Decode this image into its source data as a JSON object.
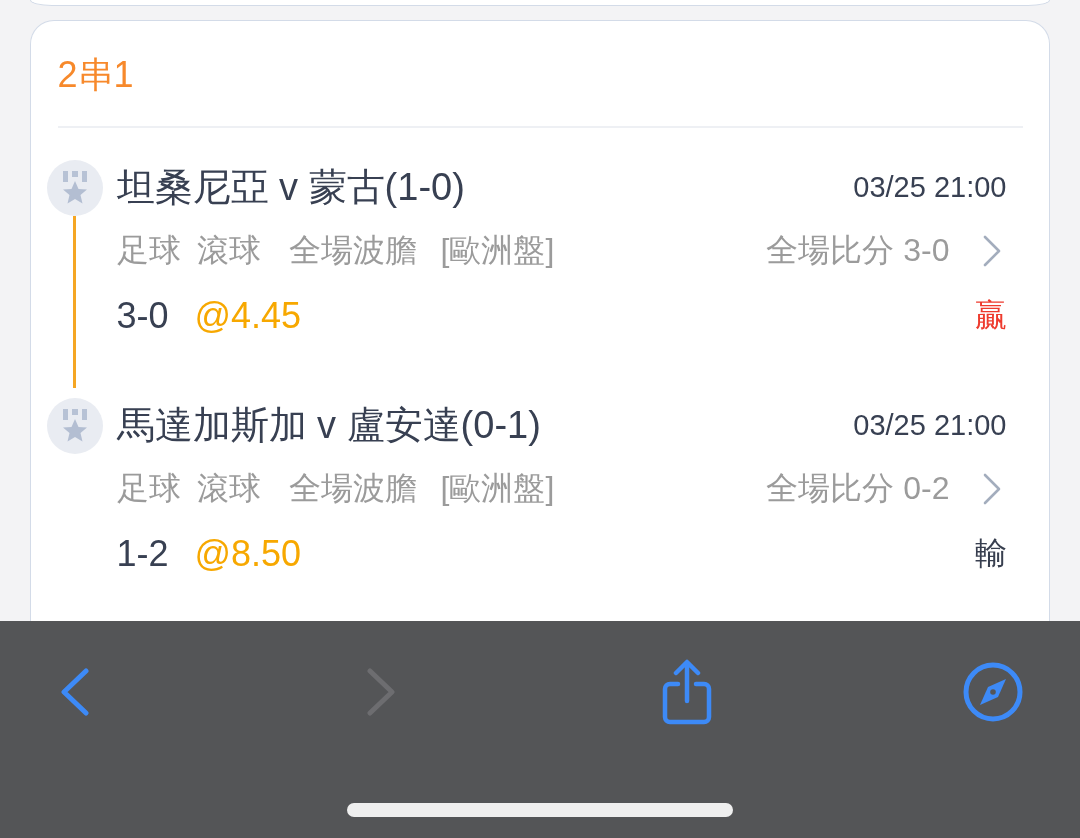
{
  "bet": {
    "title": "2串1",
    "legs": [
      {
        "match": "坦桑尼亞 v 蒙古(1-0)",
        "time": "03/25 21:00",
        "sport": "足球",
        "mode": "滾球",
        "market": "全場波膽",
        "odds_type": "[歐洲盤]",
        "full_time_score": "全場比分 3-0",
        "pick": "3-0",
        "odds": "@4.45",
        "result": {
          "text": "贏",
          "kind": "win"
        }
      },
      {
        "match": "馬達加斯加 v 盧安達(0-1)",
        "time": "03/25 21:00",
        "sport": "足球",
        "mode": "滾球",
        "market": "全場波膽",
        "odds_type": "[歐洲盤]",
        "full_time_score": "全場比分 0-2",
        "pick": "1-2",
        "odds": "@8.50",
        "result": {
          "text": "輸",
          "kind": "loss"
        }
      }
    ]
  },
  "toolbar": [
    {
      "kind": "back",
      "disabled": false
    },
    {
      "kind": "forward",
      "disabled": true
    },
    {
      "kind": "share",
      "disabled": false
    },
    {
      "kind": "compass",
      "disabled": false
    }
  ]
}
